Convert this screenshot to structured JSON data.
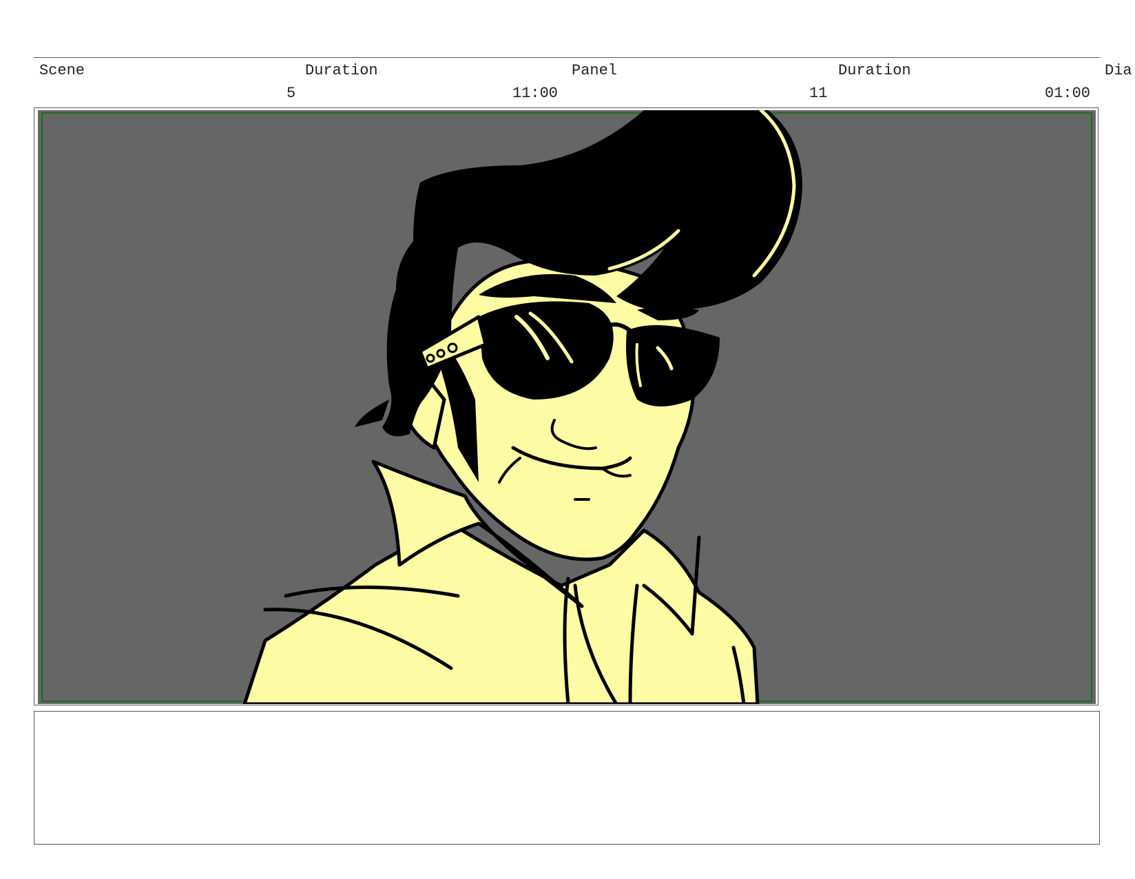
{
  "header": {
    "labels": {
      "scene": "Scene",
      "duration_1": "Duration",
      "panel": "Panel",
      "duration_2": "Duration",
      "dialogue_truncated": "Dia"
    },
    "values": {
      "scene_number": "5",
      "scene_duration": "11:00",
      "panel_number": "11",
      "panel_duration": "01:00"
    }
  },
  "panel": {
    "background_color": "#666666",
    "skin_color": "#FDFBA3",
    "ink_color": "#000000",
    "safe_frame_color": "#1E6B1E"
  },
  "notes": {
    "text": ""
  }
}
